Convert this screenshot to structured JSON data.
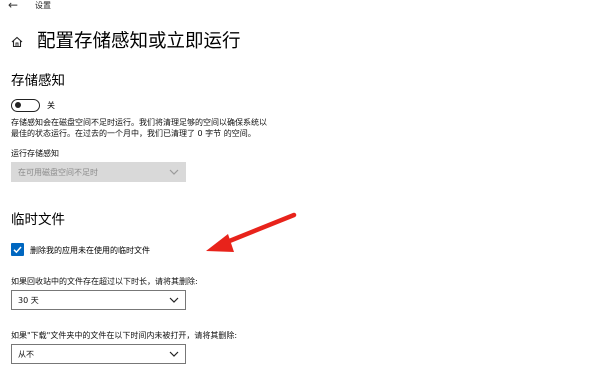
{
  "window": {
    "title": "设置",
    "back_icon": "back-arrow-icon"
  },
  "page": {
    "title": "配置存储感知或立即运行",
    "home_icon": "home-icon"
  },
  "storage_sense": {
    "heading": "存储感知",
    "toggle": {
      "state": "off",
      "label": "关"
    },
    "description_lines": [
      "存储感知会在磁盘空间不足时运行。我们将清理足够的空间以确保系统以",
      "最佳的状态运行。在过去的一个月中，我们已清理了 0 字节 的空间。"
    ],
    "run_label": "运行存储感知",
    "run_dropdown": {
      "value": "在可用磁盘空间不足时",
      "enabled": false
    }
  },
  "temp_files": {
    "heading": "临时文件",
    "checkbox": {
      "label": "删除我的应用未在使用的临时文件",
      "checked": true
    },
    "recycle_label": "如果回收站中的文件存在超过以下时长，请将其删除:",
    "recycle_dropdown": {
      "value": "30 天"
    },
    "download_label": "如果\"下载\"文件夹中的文件在以下时间内未被打开，请将其删除:",
    "download_dropdown": {
      "value": "从不"
    }
  },
  "colors": {
    "accent": "#0067c0",
    "annotation_arrow": "#e8231b"
  }
}
